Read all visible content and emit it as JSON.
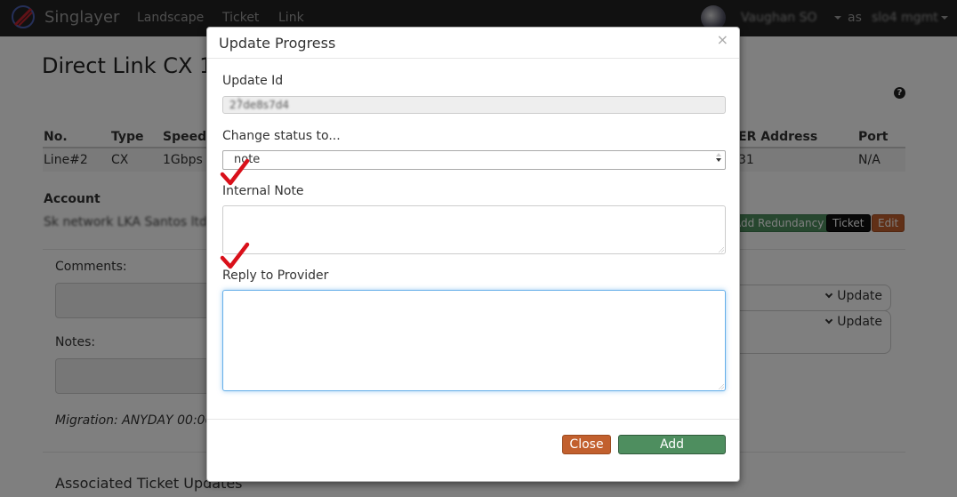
{
  "navbar": {
    "brand": "Singlayer",
    "links": [
      "Landscape",
      "Ticket",
      "Link"
    ],
    "user_name": "Vaughan SO",
    "as_label": "as",
    "role": "slo4 mgmt"
  },
  "page": {
    "title": "Direct Link CX 10",
    "table": {
      "headers": [
        "No.",
        "Type",
        "Speed",
        "ER Address",
        "Port"
      ],
      "row": [
        "Line#2",
        "CX",
        "1Gbps",
        "31",
        "N/A"
      ]
    },
    "account_label": "Account",
    "account_text": "Sk network LKA Santos ltd",
    "buttons": {
      "redundancy": "Add Redundancy",
      "ticket": "Ticket",
      "edit": "Edit"
    },
    "comments_label": "Comments:",
    "notes_label": "Notes:",
    "update_label": "Update",
    "migration_text": "Migration: ANYDAY 00:00",
    "associated_title": "Associated Ticket Updates"
  },
  "modal": {
    "title": "Update Progress",
    "close_glyph": "×",
    "update_id_label": "Update Id",
    "update_id_value": "27̀de8s7d4",
    "status_label": "Change status to...",
    "status_value": "note",
    "internal_note_label": "Internal Note",
    "reply_label": "Reply to Provider",
    "close_button": "Close",
    "add_button": "Add"
  },
  "colors": {
    "navbar_bg": "#222222",
    "close_button": "#c2602e",
    "add_button": "#4e8e5f",
    "checkmark": "#d9101a",
    "focus": "#66afe9"
  }
}
